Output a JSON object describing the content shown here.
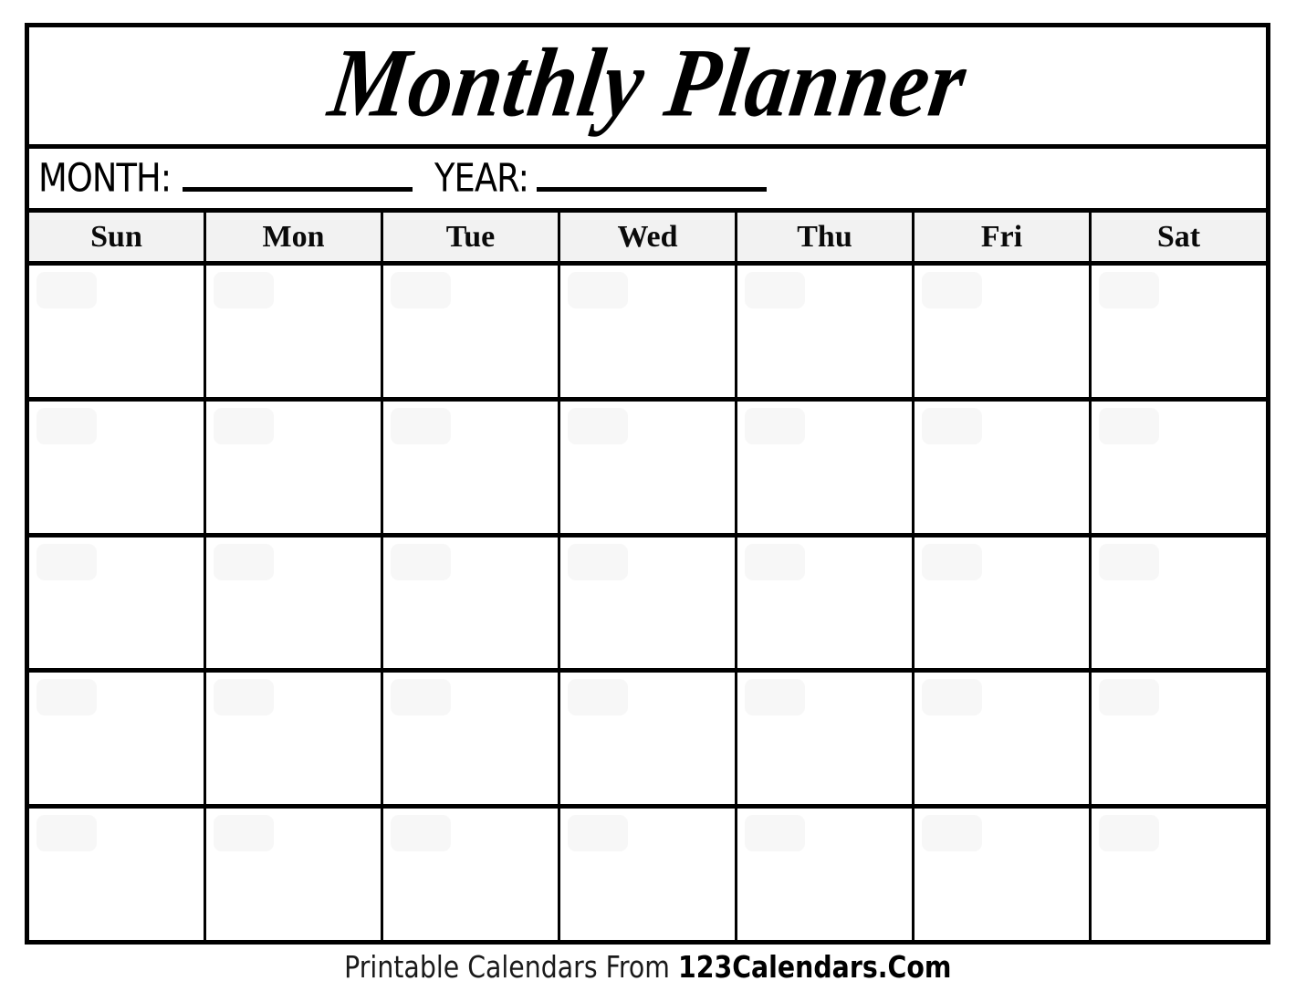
{
  "document": {
    "title": "Monthly Planner"
  },
  "fields": {
    "month_label": "MONTH:",
    "month_value": "",
    "year_label": "YEAR:",
    "year_value": ""
  },
  "calendar": {
    "weekdays": [
      "Sun",
      "Mon",
      "Tue",
      "Wed",
      "Thu",
      "Fri",
      "Sat"
    ],
    "rows": 5,
    "columns": 7,
    "cells": [
      [
        "",
        "",
        "",
        "",
        "",
        "",
        ""
      ],
      [
        "",
        "",
        "",
        "",
        "",
        "",
        ""
      ],
      [
        "",
        "",
        "",
        "",
        "",
        "",
        ""
      ],
      [
        "",
        "",
        "",
        "",
        "",
        "",
        ""
      ],
      [
        "",
        "",
        "",
        "",
        "",
        "",
        ""
      ]
    ]
  },
  "footer": {
    "prefix": "Printable Calendars From ",
    "brand": "123Calendars.Com"
  },
  "colors": {
    "border": "#000000",
    "header_background": "#f2f2f2",
    "date_slot": "#f7f7f7",
    "page_background": "#ffffff",
    "text": "#000000"
  }
}
